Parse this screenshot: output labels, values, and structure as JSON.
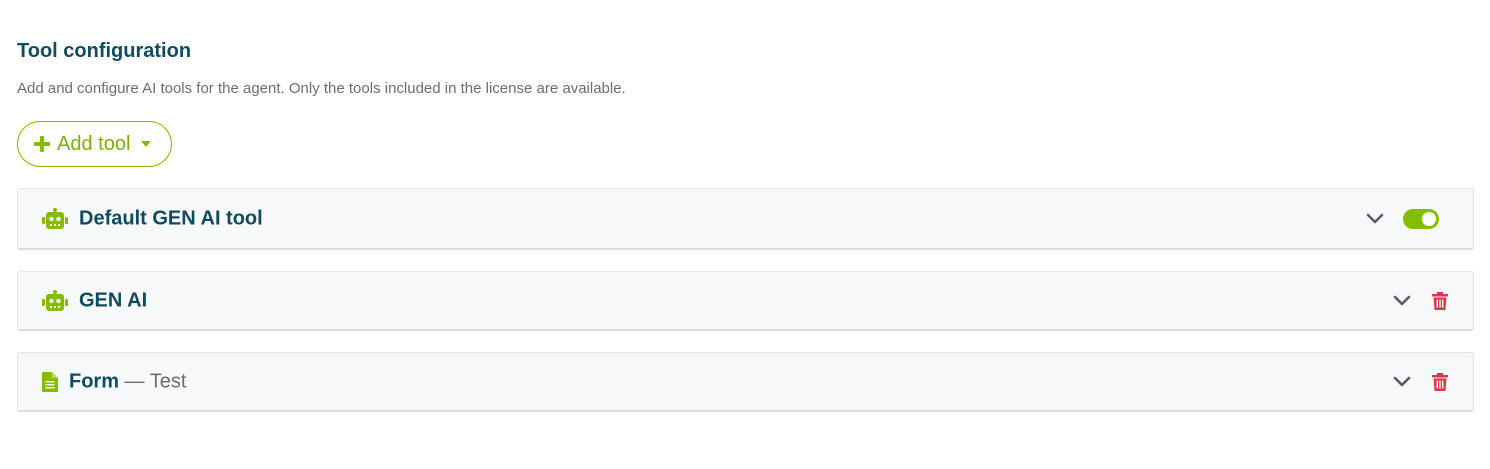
{
  "section": {
    "title": "Tool configuration",
    "description": "Add and configure AI tools for the agent. Only the tools included in the license are available."
  },
  "add_tool": {
    "label": "Add tool",
    "icon": "plus-icon",
    "dropdown_icon": "caret-down-icon"
  },
  "tools": [
    {
      "title": "Default GEN AI tool",
      "subtitle": "",
      "icon": "robot-icon",
      "enabled": true,
      "actions": [
        "chevron-down-icon",
        "toggle"
      ]
    },
    {
      "title": "GEN AI",
      "subtitle": "",
      "icon": "robot-icon",
      "actions": [
        "chevron-down-icon",
        "trash-icon"
      ]
    },
    {
      "title": "Form",
      "subtitle": " — Test",
      "icon": "document-icon",
      "actions": [
        "chevron-down-icon",
        "trash-icon"
      ]
    }
  ],
  "colors": {
    "brand_green": "#84bd00",
    "title_teal": "#114b5f",
    "danger_red": "#d9364a",
    "muted_text": "#6d6d6d",
    "panel_bg": "#f7f8f9"
  }
}
